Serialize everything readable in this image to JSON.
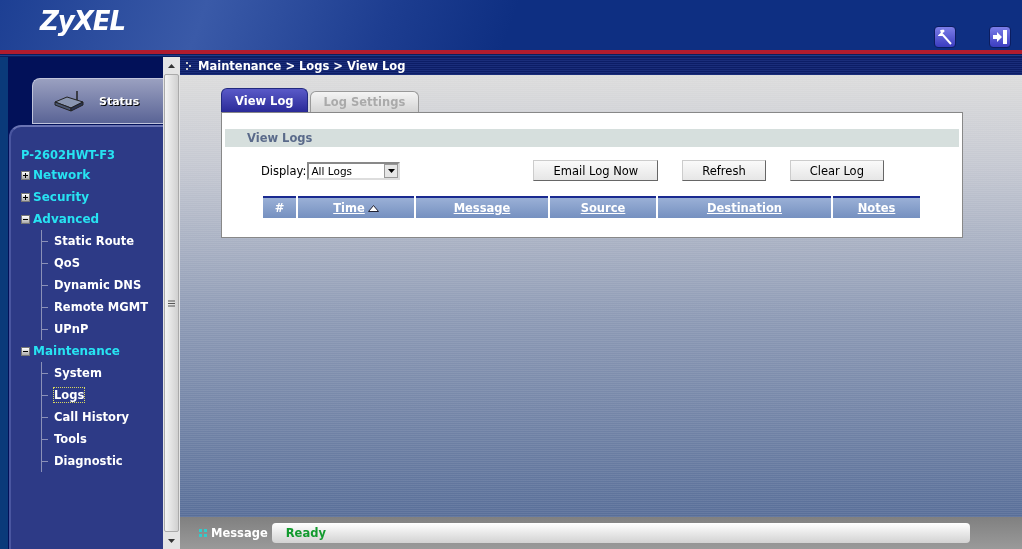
{
  "header": {
    "logo": "ZyXEL"
  },
  "sidebar": {
    "status_tab": "Status",
    "device": "P-2602HWT-F3",
    "menu": [
      {
        "label": "Network",
        "expanded": false
      },
      {
        "label": "Security",
        "expanded": false
      },
      {
        "label": "Advanced",
        "expanded": true,
        "children": [
          {
            "label": "Static Route",
            "selected": false
          },
          {
            "label": "QoS",
            "selected": false
          },
          {
            "label": "Dynamic DNS",
            "selected": false
          },
          {
            "label": "Remote MGMT",
            "selected": false
          },
          {
            "label": "UPnP",
            "selected": false
          }
        ]
      },
      {
        "label": "Maintenance",
        "expanded": true,
        "children": [
          {
            "label": "System",
            "selected": false
          },
          {
            "label": "Logs",
            "selected": true
          },
          {
            "label": "Call History",
            "selected": false
          },
          {
            "label": "Tools",
            "selected": false
          },
          {
            "label": "Diagnostic",
            "selected": false
          }
        ]
      }
    ]
  },
  "breadcrumb": "Maintenance > Logs > View Log",
  "tabs": [
    {
      "label": "View Log",
      "selected": true
    },
    {
      "label": "Log Settings",
      "selected": false
    }
  ],
  "view_logs": {
    "title": "View Logs",
    "display_label": "Display:",
    "display_value": "All Logs",
    "buttons": [
      "Email Log Now",
      "Refresh",
      "Clear Log"
    ],
    "table": {
      "columns": [
        {
          "label": "#",
          "link": false,
          "sorted": false
        },
        {
          "label": "Time",
          "link": true,
          "sorted": true
        },
        {
          "label": "Message",
          "link": true,
          "sorted": false
        },
        {
          "label": "Source",
          "link": true,
          "sorted": false
        },
        {
          "label": "Destination",
          "link": true,
          "sorted": false
        },
        {
          "label": "Notes",
          "link": true,
          "sorted": false
        }
      ]
    }
  },
  "status_bar": {
    "label": "Message",
    "value": "Ready"
  }
}
